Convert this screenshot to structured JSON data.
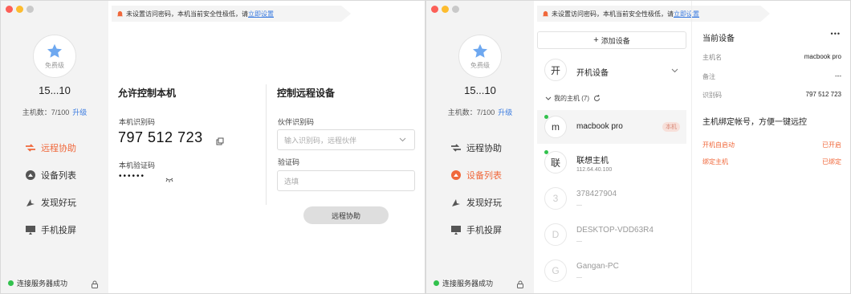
{
  "banner": {
    "text": "未设置访问密码，本机当前安全性极低，请",
    "link": "立即设置"
  },
  "sidebar": {
    "level": "免费级",
    "username": "15...10",
    "host_count_label": "主机数：7/100",
    "upgrade": "升级",
    "items": [
      {
        "label": "远程协助",
        "icon": "remote-assist-icon"
      },
      {
        "label": "设备列表",
        "icon": "device-list-icon"
      },
      {
        "label": "发现好玩",
        "icon": "discover-icon"
      },
      {
        "label": "手机投屏",
        "icon": "screen-cast-icon"
      }
    ],
    "status": "连接服务器成功"
  },
  "left_window": {
    "allow_title": "允许控制本机",
    "local_id_label": "本机识别码",
    "local_id": "797 512 723",
    "local_pwd_label": "本机验证码",
    "local_pwd": "••••••",
    "control_title": "控制远程设备",
    "partner_label": "伙伴识别码",
    "partner_placeholder": "输入识别码，远程伙伴",
    "code_label": "验证码",
    "code_placeholder": "选填",
    "assist_button": "远程协助",
    "active_nav": 0
  },
  "right_window": {
    "active_nav": 1,
    "add_device": "添加设备",
    "boot_device": {
      "letter": "开",
      "name": "开机设备"
    },
    "my_hosts_label": "我的主机 (7)",
    "devices": [
      {
        "letter": "m",
        "name": "macbook pro",
        "sub": "",
        "tag": "本机",
        "online": true,
        "grey": false
      },
      {
        "letter": "联",
        "name": "联想主机",
        "sub": "112.64.40.100",
        "tag": "",
        "online": true,
        "grey": false
      },
      {
        "letter": "3",
        "name": "378427904",
        "sub": "—",
        "tag": "",
        "online": false,
        "grey": true
      },
      {
        "letter": "D",
        "name": "DESKTOP-VDD63R4",
        "sub": "—",
        "tag": "",
        "online": false,
        "grey": true
      },
      {
        "letter": "G",
        "name": "Gangan-PC",
        "sub": "—",
        "tag": "",
        "online": false,
        "grey": true
      }
    ],
    "panel": {
      "title": "当前设备",
      "more": "•••",
      "host_name_label": "主机名",
      "host_name": "macbook pro",
      "note_label": "备注",
      "note": "---",
      "id_label": "识别码",
      "id": "797 512 723",
      "bind_title": "主机绑定帐号，方便一键远控",
      "autostart_label": "开机自启动",
      "autostart_value": "已开启",
      "bind_label": "绑定主机",
      "bind_value": "已绑定"
    }
  },
  "colors": {
    "accent": "#f0683b",
    "link": "#3a7be0",
    "online": "#32c24d"
  }
}
